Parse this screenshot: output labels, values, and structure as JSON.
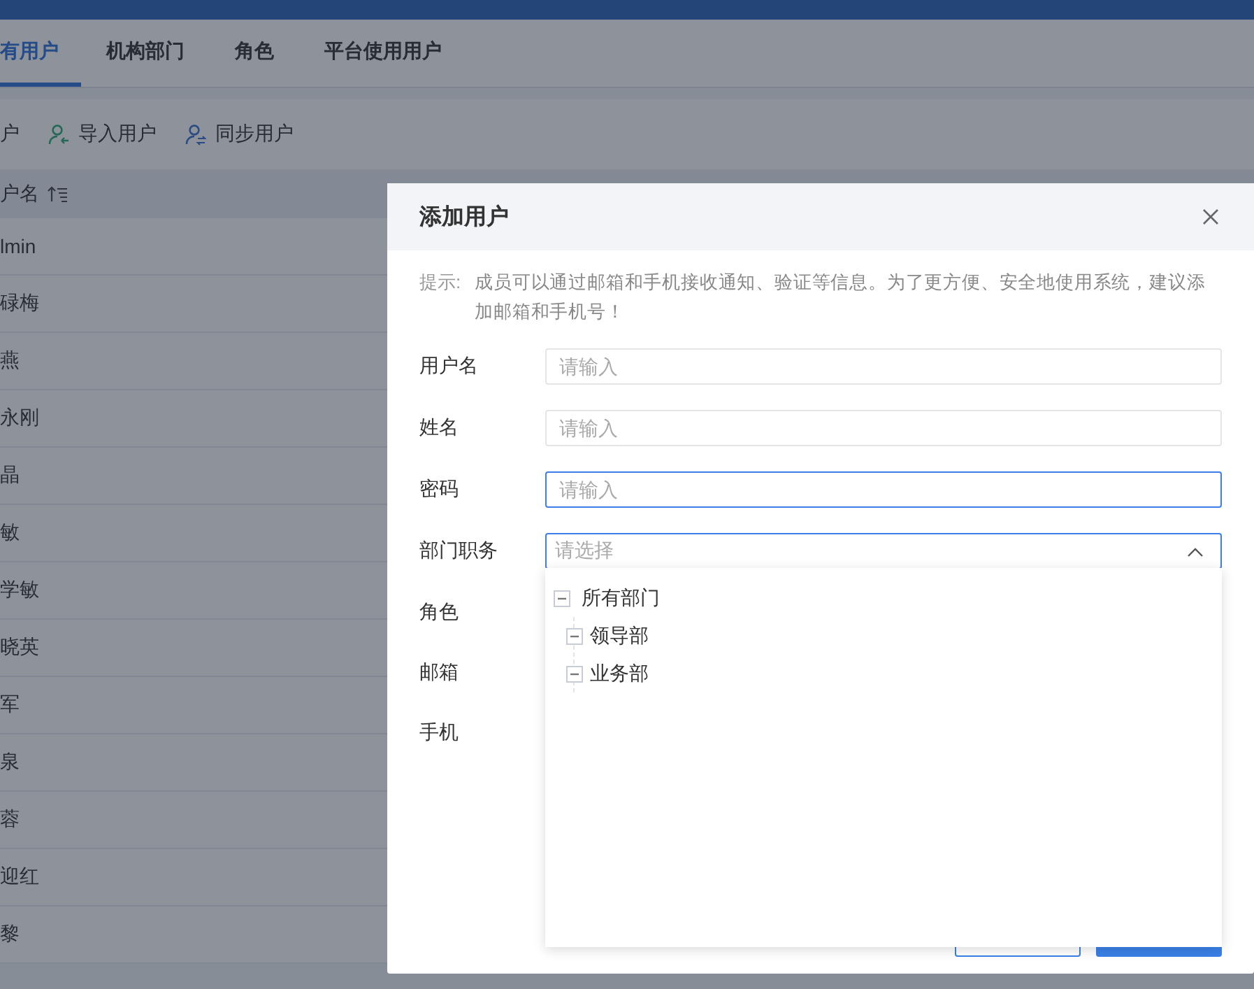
{
  "tabs": [
    {
      "label": "有用户",
      "selected": true
    },
    {
      "label": "机构部门",
      "selected": false
    },
    {
      "label": "角色",
      "selected": false
    },
    {
      "label": "平台使用用户",
      "selected": false
    }
  ],
  "toolbar": [
    {
      "label": "户",
      "kind": "plain"
    },
    {
      "label": "导入用户",
      "kind": "import"
    },
    {
      "label": "同步用户",
      "kind": "sync"
    }
  ],
  "table": {
    "columns": [
      "户名"
    ],
    "rows": [
      [
        "lmin"
      ],
      [
        "碌梅"
      ],
      [
        "燕"
      ],
      [
        "永刚"
      ],
      [
        "晶"
      ],
      [
        "敏"
      ],
      [
        "学敏"
      ],
      [
        "晓英"
      ],
      [
        "军"
      ],
      [
        "泉"
      ],
      [
        "蓉"
      ],
      [
        "迎红"
      ],
      [
        "黎"
      ]
    ]
  },
  "dialog": {
    "title": "添加用户",
    "hint_label": "提示:",
    "hint": "成员可以通过邮箱和手机接收通知、验证等信息。为了更方便、安全地使用系统，建议添加邮箱和手机号！",
    "fields": [
      {
        "label": "用户名",
        "kind": "input",
        "placeholder": "请输入",
        "focused": false
      },
      {
        "label": "姓名",
        "kind": "input",
        "placeholder": "请输入",
        "focused": false
      },
      {
        "label": "密码",
        "kind": "input",
        "placeholder": "请输入",
        "focused": true
      },
      {
        "label": "部门职务",
        "kind": "select",
        "placeholder": "请选择",
        "focused": true,
        "expanded": true
      },
      {
        "label": "角色",
        "kind": "hidden"
      },
      {
        "label": "邮箱",
        "kind": "hidden"
      },
      {
        "label": "手机",
        "kind": "hidden"
      }
    ],
    "tree": [
      {
        "label": "所有部门",
        "expanded": true,
        "children": [
          {
            "label": "领导部",
            "expanded": true
          },
          {
            "label": "业务部",
            "expanded": true
          }
        ]
      }
    ]
  }
}
